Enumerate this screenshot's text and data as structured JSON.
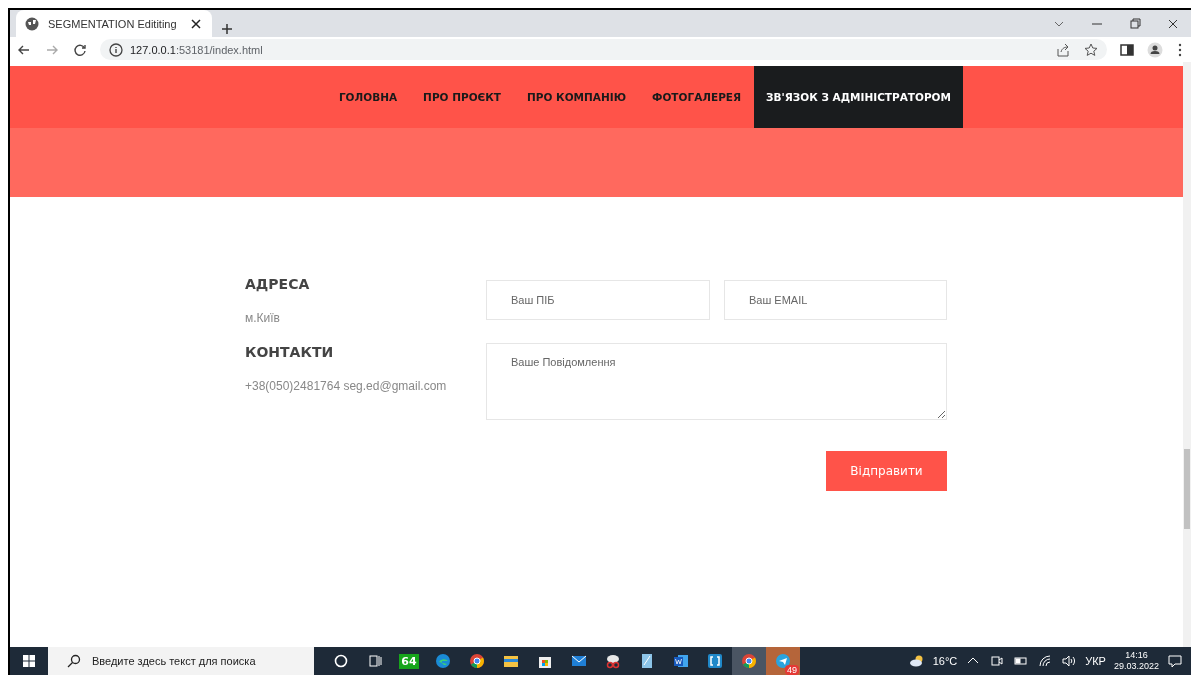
{
  "browser": {
    "tab_title": "SEGMENTATION Edititing",
    "url_host": "127.0.0.1",
    "url_rest": ":53181/index.html"
  },
  "nav": [
    {
      "label": "ГОЛОВНА",
      "selected": false
    },
    {
      "label": "ПРО ПРОЄКТ",
      "selected": false
    },
    {
      "label": "ПРО КОМПАНІЮ",
      "selected": false
    },
    {
      "label": "ФОТОГАЛЕРЕЯ",
      "selected": false
    },
    {
      "label": "ЗВ'ЯЗОК З АДМІНІСТРАТОРОМ",
      "selected": true
    }
  ],
  "contact": {
    "address_heading": "АДРЕСА",
    "address": "м.Київ",
    "contacts_heading": "КОНТАКТИ",
    "contacts": "+38(050)2481764 seg.ed@gmail.com"
  },
  "form": {
    "name": {
      "placeholder": "Ваш ПІБ"
    },
    "email": {
      "placeholder": "Ваш EMAIL"
    },
    "message": {
      "placeholder": "Ваше Повідомлення"
    },
    "submit": "Відправити"
  },
  "taskbar": {
    "search": {
      "placeholder": "Введите здесь текст для поиска"
    },
    "apps": [
      {
        "kind": "cortana",
        "active": false
      },
      {
        "kind": "taskview",
        "active": false
      },
      {
        "kind": "counter",
        "label": "64",
        "active": false
      },
      {
        "kind": "edge",
        "active": false
      },
      {
        "kind": "chrome",
        "active": false
      },
      {
        "kind": "folder",
        "active": false
      },
      {
        "kind": "store",
        "active": false
      },
      {
        "kind": "mail",
        "active": false
      },
      {
        "kind": "snip",
        "active": false
      },
      {
        "kind": "tablet",
        "active": false
      },
      {
        "kind": "word",
        "active": false
      },
      {
        "kind": "brackets",
        "active": false
      },
      {
        "kind": "chrome",
        "active": true
      },
      {
        "kind": "telegram",
        "active": true,
        "badge": "49"
      }
    ],
    "weather": "16°C",
    "language": "УКР",
    "time": "14:16",
    "date": "29.03.2022"
  }
}
